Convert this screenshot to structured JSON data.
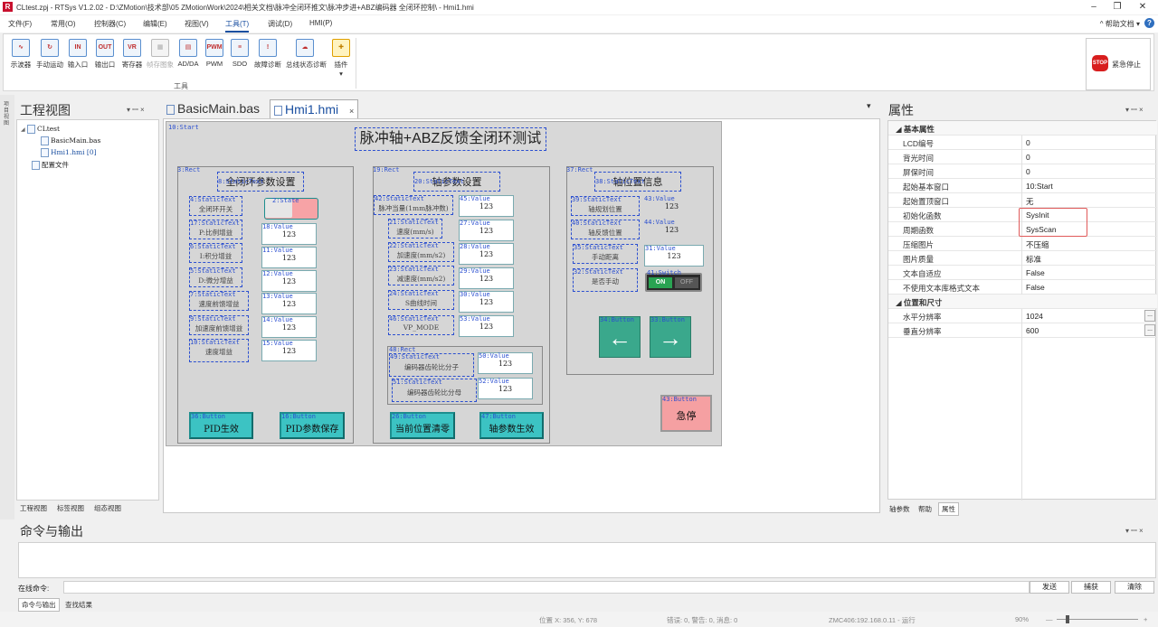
{
  "window": {
    "title": "CLtest.zpj - RTSys V1.2.02 - D:\\ZMotion\\技术部\\05 ZMotionWork\\2024\\相关文档\\脉冲全闭环推文\\脉冲步进+ABZ编码器 全闭环控制\\ - Hmi1.hmi",
    "logo": "R",
    "min": "–",
    "restore": "❐",
    "close": "✕"
  },
  "menu": {
    "items": [
      "文件(F)",
      "常用(O)",
      "控制器(C)",
      "编辑(E)",
      "视图(V)",
      "工具(T)",
      "调试(D)",
      "HMI(P)"
    ],
    "active_index": 5,
    "help": "^ 帮助文档 ▾",
    "help_q": "?"
  },
  "ribbon": {
    "tools": [
      {
        "label": "示波器",
        "icon": "oscilloscope-icon",
        "glyph": "∿"
      },
      {
        "label": "手动运动",
        "icon": "manual-motion-icon",
        "glyph": "↻"
      },
      {
        "label": "输入口",
        "icon": "input-port-icon",
        "glyph": "IN"
      },
      {
        "label": "输出口",
        "icon": "output-port-icon",
        "glyph": "OUT"
      },
      {
        "label": "寄存器",
        "icon": "register-icon",
        "glyph": "VR"
      },
      {
        "label": "帧存图象",
        "icon": "frame-image-icon",
        "glyph": "▦",
        "disabled": true
      },
      {
        "label": "AD/DA",
        "icon": "adda-icon",
        "glyph": "▤"
      },
      {
        "label": "PWM",
        "icon": "pwm-icon",
        "glyph": "PWM"
      },
      {
        "label": "SDO",
        "icon": "sdo-icon",
        "glyph": "≡"
      },
      {
        "label": "故障诊断",
        "icon": "diagnosis-icon",
        "glyph": "!"
      },
      {
        "label": "总线状态诊断",
        "icon": "bus-diagnosis-icon",
        "glyph": "☁"
      },
      {
        "label": "插件",
        "icon": "plugin-icon",
        "glyph": "✚"
      }
    ],
    "plugin_arrow": "▾",
    "group_label": "工具",
    "estop_sign": "STOP",
    "estop_label": "紧急停止"
  },
  "left_strip": "项目视图",
  "project_panel": {
    "title": "工程视图",
    "pin": "▾ ꟷ ×",
    "tree": [
      {
        "text": "CLtest",
        "indent": 0,
        "expand": "◢"
      },
      {
        "text": "BasicMain.bas",
        "indent": 1
      },
      {
        "text": "Hmi1.hmi [0]",
        "indent": 1
      },
      {
        "text": "配置文件",
        "indent": 0
      }
    ],
    "bottom_tabs": [
      "工程视图",
      "标签视图",
      "组态视图"
    ]
  },
  "editor": {
    "tabs": [
      {
        "label": "BasicMain.bas",
        "active": false
      },
      {
        "label": "Hmi1.hmi",
        "active": true
      }
    ],
    "tab_close": "×",
    "dropdown": "▾"
  },
  "hmi": {
    "window_label": "10:Start",
    "title": "脉冲轴+ABZ反馈全闭环测试",
    "sec1": {
      "rect_label": "3:Rect",
      "title_label": "8:StaticText",
      "title": "全闭环参数设置",
      "rows": [
        {
          "lab": "4:StaticText",
          "text": "全闭环开关"
        },
        {
          "lab": "17:StaticText",
          "text": "P:比例增益"
        },
        {
          "lab": "6:StaticText",
          "text": "I:积分增益"
        },
        {
          "lab": "5:StaticText",
          "text": "D:微分增益"
        },
        {
          "lab": "7:StaticText",
          "text": "速度前馈增益"
        },
        {
          "lab": "9:StaticText",
          "text": "加速度前馈增益"
        },
        {
          "lab": "10:StaticText",
          "text": "速度增益"
        }
      ],
      "state_label": "2:State",
      "values": [
        {
          "lab": "18:Value",
          "v": "123"
        },
        {
          "lab": "11:Value",
          "v": "123"
        },
        {
          "lab": "12:Value",
          "v": "123"
        },
        {
          "lab": "13:Value",
          "v": "123"
        },
        {
          "lab": "14:Value",
          "v": "123"
        },
        {
          "lab": "15:Value",
          "v": "123"
        }
      ],
      "btn1_lab": "36:Button",
      "btn1": "PID生效",
      "btn2_lab": "16:Button",
      "btn2": "PID参数保存"
    },
    "sec2": {
      "rect_label": "19:Rect",
      "title_label": "20:StaticText",
      "title": "轴参数设置",
      "rows": [
        {
          "lab": "42:StaticText",
          "text": "脉冲当量(1mm脉冲数)"
        },
        {
          "lab": "21:StaticText",
          "text": "速度(mm/s)"
        },
        {
          "lab": "22:StaticText",
          "text": "加速度(mm/s2)"
        },
        {
          "lab": "23:StaticText",
          "text": "减速度(mm/s2)"
        },
        {
          "lab": "24:StaticText",
          "text": "S曲线时间"
        },
        {
          "lab": "46:StaticText",
          "text": "VP_MODE"
        }
      ],
      "values": [
        {
          "lab": "45:Value",
          "v": "123"
        },
        {
          "lab": "27:Value",
          "v": "123"
        },
        {
          "lab": "28:Value",
          "v": "123"
        },
        {
          "lab": "29:Value",
          "v": "123"
        },
        {
          "lab": "30:Value",
          "v": "123"
        },
        {
          "lab": "53:Value",
          "v": "123"
        }
      ],
      "sub_rect_label": "48:Rect",
      "sub_rows": [
        {
          "lab": "49:StaticText",
          "text": "编码器齿轮比分子"
        },
        {
          "lab": "51:StaticText",
          "text": "编码器齿轮比分母"
        }
      ],
      "sub_values": [
        {
          "lab": "50:Value",
          "v": "123"
        },
        {
          "lab": "52:Value",
          "v": "123"
        }
      ],
      "btn1_lab": "26:Button",
      "btn1": "当前位置清零",
      "btn2_lab": "47:Button",
      "btn2": "轴参数生效"
    },
    "sec3": {
      "rect_label": "37:Rect",
      "title_label": "38:StaticText",
      "title": "轴位置信息",
      "rows": [
        {
          "lab": "39:StaticText",
          "text": "轴规划位置"
        },
        {
          "lab": "40:StaticText",
          "text": "轴反馈位置"
        },
        {
          "lab": "35:StaticText",
          "text": "手动距离"
        },
        {
          "lab": "32:StaticText",
          "text": "是否手动"
        }
      ],
      "values": [
        {
          "lab": "43:Value",
          "v": "123"
        },
        {
          "lab": "44:Value",
          "v": "123"
        },
        {
          "lab": "31:Value",
          "v": "123"
        }
      ],
      "switch_lab": "41:Switch",
      "switch_on": "ON",
      "switch_off": "OFF",
      "left_lab": "34:Button",
      "left_arrow": "←",
      "right_lab": "33:Button",
      "right_arrow": "→"
    },
    "estop_lab": "43:Button",
    "estop": "急停"
  },
  "properties": {
    "title": "属性",
    "pin": "▾ ꟷ ×",
    "rows": [
      {
        "cat": true,
        "k": "基本属性"
      },
      {
        "k": "LCD编号",
        "v": "0"
      },
      {
        "k": "背光时间",
        "v": "0"
      },
      {
        "k": "屏保时间",
        "v": "0"
      },
      {
        "k": "起始基本窗口",
        "v": "10:Start"
      },
      {
        "k": "起始置顶窗口",
        "v": "无"
      },
      {
        "k": "初始化函数",
        "v": "SysInit"
      },
      {
        "k": "周期函数",
        "v": "SysScan"
      },
      {
        "k": "压缩图片",
        "v": "不压缩"
      },
      {
        "k": "图片质量",
        "v": "标准"
      },
      {
        "k": "文本自适应",
        "v": "False"
      },
      {
        "k": "不使用文本库格式文本",
        "v": "False"
      },
      {
        "cat": true,
        "k": "位置和尺寸"
      },
      {
        "k": "水平分辨率",
        "v": "1024",
        "ellipsis": true
      },
      {
        "k": "垂直分辨率",
        "v": "600",
        "ellipsis": true
      }
    ],
    "ellipsis": "...",
    "bottom_tabs": [
      "轴参数",
      "帮助",
      "属性"
    ]
  },
  "output": {
    "title": "命令与输出",
    "pin": "▾ ꟷ ×",
    "cmd_label": "在线命令:",
    "buttons": [
      "发送",
      "捕获",
      "清除"
    ],
    "bottom_tabs": [
      "命令与输出",
      "查找结果"
    ]
  },
  "status": {
    "pos": "位置 X: 356, Y: 678",
    "errors": "错误: 0, 警告: 0, 消息: 0",
    "controller": "ZMC406:192.168.0.11 - 运行",
    "zoom": "90%",
    "zoom_minus": "—",
    "zoom_plus": "+"
  }
}
